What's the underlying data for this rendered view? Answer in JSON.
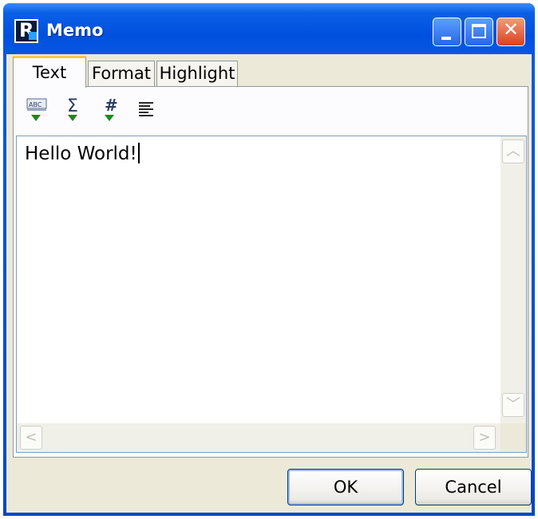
{
  "window": {
    "title": "Memo",
    "app_icon_letter": "R"
  },
  "title_buttons": {
    "minimize": "minimize-icon",
    "maximize": "maximize-icon",
    "close_glyph": "✕"
  },
  "tabs": [
    {
      "label": "Text",
      "active": true
    },
    {
      "label": "Format",
      "active": false
    },
    {
      "label": "Highlight",
      "active": false
    }
  ],
  "toolbar": [
    {
      "icon": "spell-check-icon"
    },
    {
      "icon": "sum-icon",
      "glyph": "Σ"
    },
    {
      "icon": "number-format-icon",
      "glyph": "#"
    },
    {
      "icon": "align-text-icon"
    }
  ],
  "memo": {
    "text": "Hello World!"
  },
  "scroll_glyphs": {
    "up": "︿",
    "down": "﹀",
    "left": "<",
    "right": ">"
  },
  "buttons": {
    "ok": "OK",
    "cancel": "Cancel"
  },
  "colors": {
    "title_blue": "#0050de",
    "close_red": "#d8421c",
    "face": "#ece9d8",
    "tab_highlight": "#ffc83c",
    "arrow_green": "#1a8a1a"
  }
}
